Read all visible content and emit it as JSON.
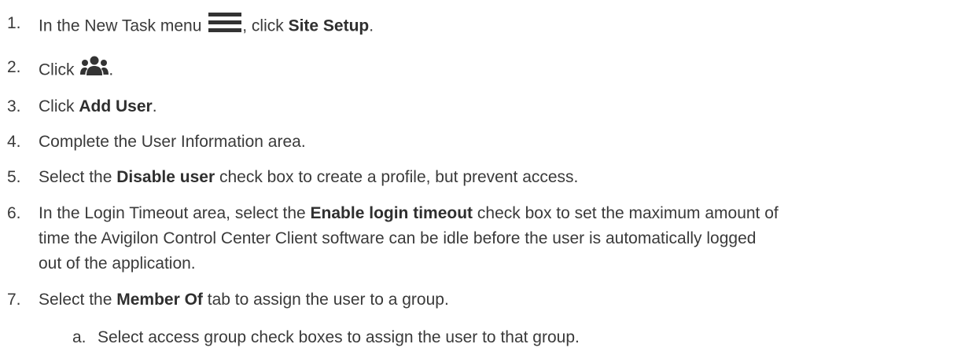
{
  "steps": [
    {
      "num": "1.",
      "pre": "In the New Task menu ",
      "icon": "hamburger-menu-icon",
      "post": ", click ",
      "bold": "Site Setup",
      "tail": "."
    },
    {
      "num": "2.",
      "pre": "Click ",
      "icon": "users-group-icon",
      "tail": "."
    },
    {
      "num": "3.",
      "pre": "Click ",
      "bold": "Add User",
      "tail": "."
    },
    {
      "num": "4.",
      "text": "Complete the User Information area."
    },
    {
      "num": "5.",
      "pre": "Select the ",
      "bold": "Disable user",
      "tail": " check box to create a profile, but prevent access."
    },
    {
      "num": "6.",
      "pre": "In the Login Timeout area, select the ",
      "bold": "Enable login timeout",
      "tail": " check box to set the maximum amount of",
      "line2": "time the Avigilon Control Center Client software can be idle before the user is automatically logged",
      "line3": "out of the application."
    },
    {
      "num": "7.",
      "pre": "Select the ",
      "bold": "Member Of",
      "tail": " tab to assign the user to a group."
    }
  ],
  "substeps": [
    {
      "num": "a.",
      "text": "Select access group check boxes to assign the user to that group."
    }
  ]
}
